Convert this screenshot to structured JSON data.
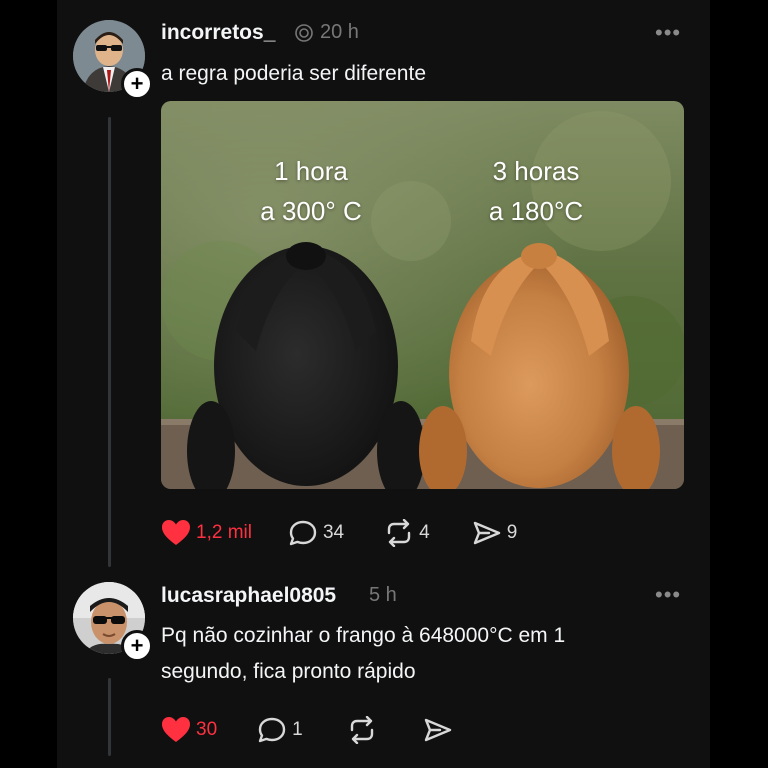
{
  "colors": {
    "background": "#000000",
    "card": "#101010",
    "text": "#f3f5f7",
    "muted": "#777777",
    "like": "#ff3040"
  },
  "post": {
    "username": "incorretos_",
    "verified_icon": "threads-spiral-icon",
    "time": "20 h",
    "text": "a regra poderia ser diferente",
    "image": {
      "left_label": "1 hora\na 300° C",
      "right_label": "3 horas\na 180°C"
    },
    "actions": {
      "likes": "1,2 mil",
      "comments": "34",
      "reposts": "4",
      "shares": "9",
      "liked": true
    }
  },
  "reply": {
    "username": "lucasraphael0805",
    "time": "5 h",
    "text_line1": "Pq não cozinhar o frango à 648000°C em 1",
    "text_line2": "segundo, fica pronto rápido",
    "actions": {
      "likes": "30",
      "comments": "1",
      "reposts": "",
      "shares": "",
      "liked": true
    }
  },
  "icons": {
    "more": "more-dots-icon",
    "heart": "heart-icon",
    "comment": "comment-bubble-icon",
    "repost": "repost-icon",
    "share": "send-icon",
    "follow": "plus-icon"
  },
  "glyphs": {
    "more": "•••",
    "plus": "+"
  }
}
